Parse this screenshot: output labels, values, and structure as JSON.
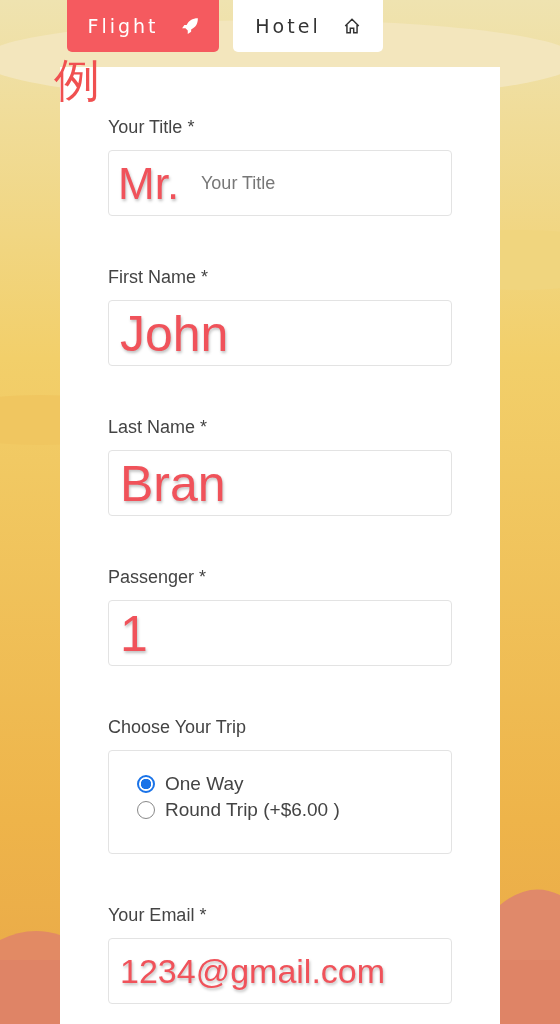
{
  "tabs": [
    {
      "label": "Flight",
      "selected": true
    },
    {
      "label": "Hotel",
      "selected": false
    }
  ],
  "annotation_mark": "例",
  "form": [
    {
      "kind": "text",
      "label": "Your Title *",
      "placeholder": "Your Title",
      "annotation": "Mr."
    },
    {
      "kind": "text",
      "label": "First Name *",
      "annotation": "John"
    },
    {
      "kind": "text",
      "label": "Last Name *",
      "annotation": "Bran"
    },
    {
      "kind": "text",
      "label": "Passenger *",
      "annotation": "1"
    },
    {
      "kind": "radio",
      "label": "Choose Your Trip",
      "options": [
        {
          "label": "One Way",
          "selected": true
        },
        {
          "label": "Round Trip (+$6.00 )",
          "selected": false
        }
      ]
    },
    {
      "kind": "email",
      "label": "Your Email *",
      "annotation": "1234@gmail.com"
    }
  ]
}
